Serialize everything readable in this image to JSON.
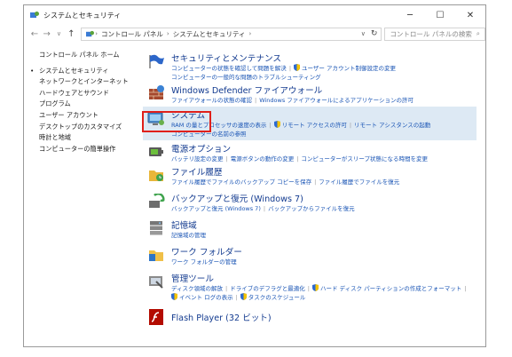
{
  "title": "システムとセキュリティ",
  "window_controls": {
    "minimize": "─",
    "maximize": "☐",
    "close": "✕"
  },
  "address": {
    "back": "←",
    "forward": "→",
    "up": "↑",
    "segments": [
      "コントロール パネル",
      "システムとセキュリティ"
    ],
    "separator": "›",
    "dropdown": "∨",
    "refresh": "↻",
    "search_placeholder": "コントロール パネルの検索",
    "search_icon": "⌕"
  },
  "sidebar": {
    "items": [
      {
        "label": "コントロール パネル ホーム"
      },
      {
        "label": "システムとセキュリティ"
      },
      {
        "label": "ネットワークとインターネット"
      },
      {
        "label": "ハードウェアとサウンド"
      },
      {
        "label": "プログラム"
      },
      {
        "label": "ユーザー アカウント"
      },
      {
        "label": "デスクトップのカスタマイズ"
      },
      {
        "label": "時計と地域"
      },
      {
        "label": "コンピューターの簡単操作"
      }
    ]
  },
  "categories": [
    {
      "title": "セキュリティとメンテナンス",
      "icon": "flag-icon",
      "lines": [
        [
          "コンピューターの状態を確認して問題を解決",
          "ユーザー アカウント制御設定の変更"
        ],
        [
          "コンピューターの一般的な問題のトラブルシューティング"
        ]
      ]
    },
    {
      "title": "Windows Defender ファイアウォール",
      "icon": "firewall-icon",
      "lines": [
        [
          "ファイアウォールの状態の確認",
          "Windows ファイアウォールによるアプリケーションの許可"
        ]
      ]
    },
    {
      "title": "システム",
      "icon": "system-icon",
      "lines": [
        [
          "RAM の量とプロセッサの速度の表示",
          "リモート アクセスの許可",
          "リモート アシスタンスの起動"
        ],
        [
          "コンピューターの名前の参照"
        ]
      ]
    },
    {
      "title": "電源オプション",
      "icon": "power-options-icon",
      "lines": [
        [
          "バッテリ設定の変更",
          "電源ボタンの動作の変更",
          "コンピューターがスリープ状態になる時間を変更"
        ]
      ]
    },
    {
      "title": "ファイル履歴",
      "icon": "file-history-icon",
      "lines": [
        [
          "ファイル履歴でファイルのバックアップ コピーを保存",
          "ファイル履歴でファイルを復元"
        ]
      ]
    },
    {
      "title": "バックアップと復元 (Windows 7)",
      "icon": "backup-restore-icon",
      "lines": [
        [
          "バックアップと復元 (Windows 7)",
          "バックアップからファイルを復元"
        ]
      ]
    },
    {
      "title": "記憶域",
      "icon": "storage-spaces-icon",
      "lines": [
        [
          "記憶域の管理"
        ]
      ]
    },
    {
      "title": "ワーク フォルダー",
      "icon": "work-folders-icon",
      "lines": [
        [
          "ワーク フォルダーの管理"
        ]
      ]
    },
    {
      "title": "管理ツール",
      "icon": "admin-tools-icon",
      "lines": [
        [
          "ディスク領域の解放",
          "ドライブのデフラグと最適化",
          "ハード ディスク パーティションの作成とフォーマット"
        ],
        [
          "イベント ログの表示",
          "タスクのスケジュール"
        ]
      ]
    },
    {
      "title": "Flash Player (32 ビット)",
      "icon": "flash-player-icon",
      "lines": []
    }
  ]
}
